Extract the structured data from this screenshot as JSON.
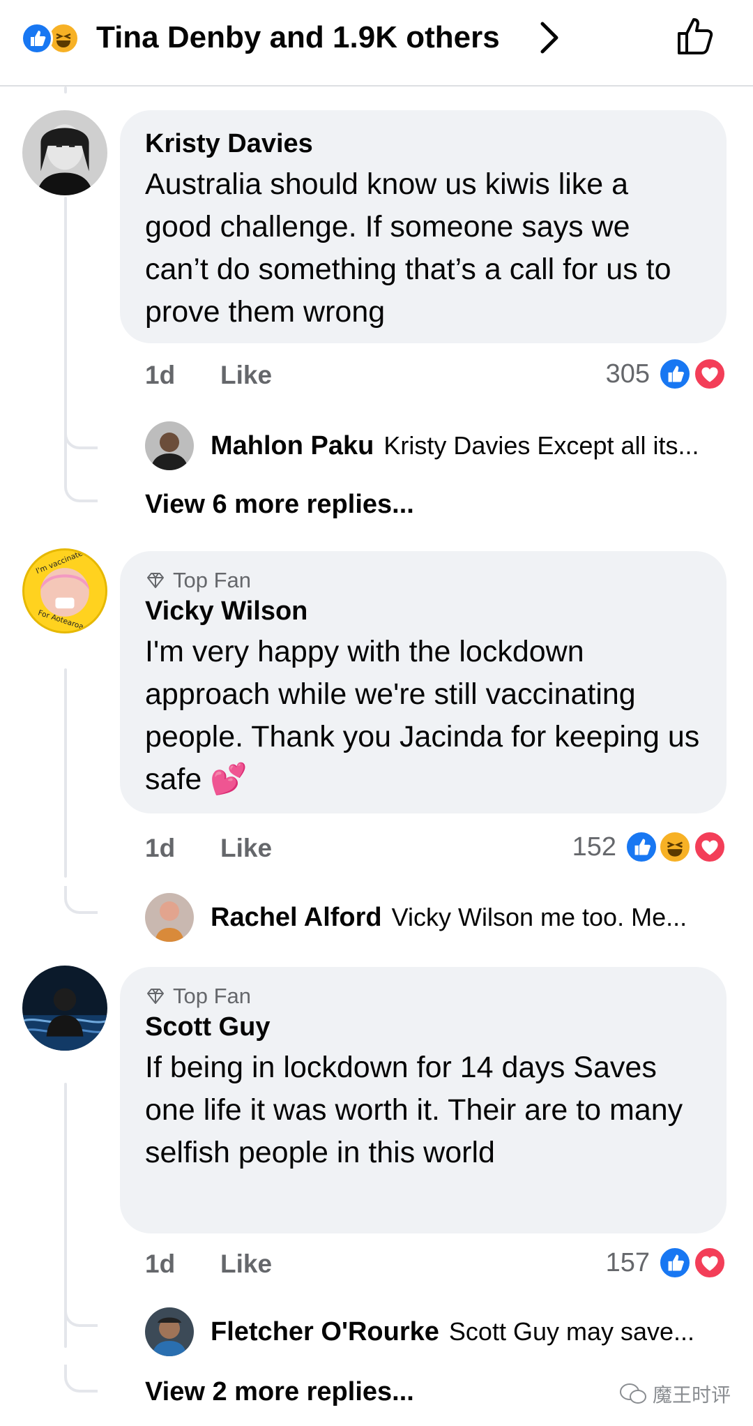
{
  "header": {
    "reactions": [
      "like-icon",
      "haha-icon"
    ],
    "summary": "Tina Denby and 1.9K others"
  },
  "comments": [
    {
      "author": "Kristy Davies",
      "badge": "",
      "text": "Australia should know us kiwis like a good challenge. If someone says we can’t do something that’s a call for us to prove them wrong",
      "time": "1d",
      "like_label": "Like",
      "reaction_count": "305",
      "reaction_icons": [
        "like-icon",
        "love-icon"
      ],
      "reply_preview": {
        "author": "Mahlon Paku",
        "text": "Kristy Davies Except all its..."
      },
      "more_replies": "View 6 more replies..."
    },
    {
      "author": "Vicky Wilson",
      "badge": "Top Fan",
      "avatar_ring_text": [
        "I'm vaccinated",
        "For Aotearoa"
      ],
      "text": "I'm very happy with the lockdown approach while we're still vaccinating people. Thank you Jacinda for keeping us safe 💕",
      "time": "1d",
      "like_label": "Like",
      "reaction_count": "152",
      "reaction_icons": [
        "like-icon",
        "haha-icon",
        "love-icon"
      ],
      "reply_preview": {
        "author": "Rachel Alford",
        "text": "Vicky Wilson me too. Me..."
      },
      "more_replies": ""
    },
    {
      "author": "Scott Guy",
      "badge": "Top Fan",
      "text": "If being in lockdown for 14 days Saves one life it was worth it. Their are to many selfish people in this world",
      "time": "1d",
      "like_label": "Like",
      "reaction_count": "157",
      "reaction_icons": [
        "like-icon",
        "love-icon"
      ],
      "reply_preview": {
        "author": "Fletcher O'Rourke",
        "text": "Scott Guy may save..."
      },
      "more_replies": "View 2 more replies..."
    }
  ],
  "watermark": "魔王时评",
  "colors": {
    "like": "#1877f2",
    "love": "#f33e58",
    "haha": "#f7b125",
    "bubble": "#f0f2f5",
    "meta": "#65676b"
  }
}
